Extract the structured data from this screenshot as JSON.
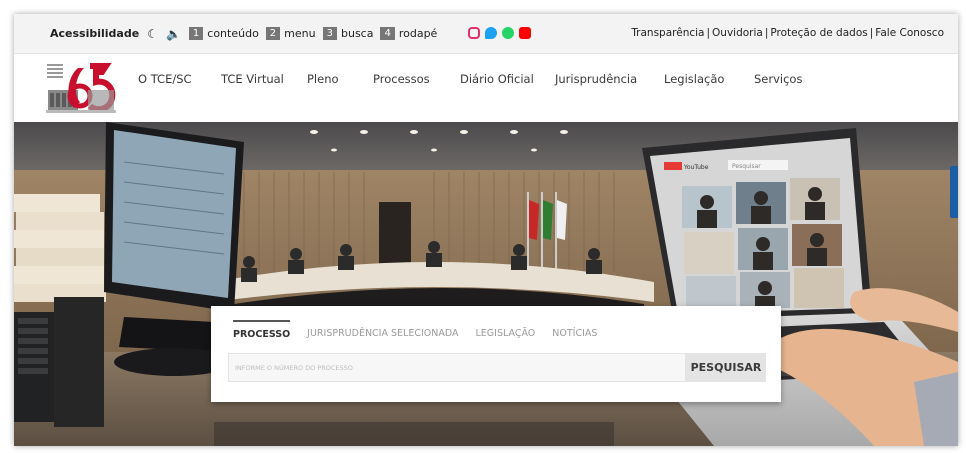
{
  "accessibility_bar": {
    "label": "Acessibilidade",
    "shortcuts": [
      {
        "num": "1",
        "text": "conteúdo"
      },
      {
        "num": "2",
        "text": "menu"
      },
      {
        "num": "3",
        "text": "busca"
      },
      {
        "num": "4",
        "text": "rodapé"
      }
    ],
    "links": [
      "Transparência",
      "Ouvidoria",
      "Proteção de dados",
      "Fale Conosco"
    ],
    "separator": "|",
    "social_colors": {
      "instagram": "#e1306c",
      "twitter": "#1da1f2",
      "whatsapp": "#25d366",
      "youtube": "#ff0000"
    }
  },
  "nav": {
    "items": [
      "O TCE/SC",
      "TCE Virtual",
      "Pleno",
      "Processos",
      "Diário Oficial",
      "Jurisprudência",
      "Legislação",
      "Serviços"
    ]
  },
  "search": {
    "tabs": [
      "PROCESSO",
      "JURISPRUDÊNCIA SELECIONADA",
      "LEGISLAÇÃO",
      "NOTÍCIAS"
    ],
    "active_tab": "PROCESSO",
    "placeholder": "INFORME O NÚMERO DO PROCESSO",
    "button_label": "PESQUISAR"
  },
  "hero": {
    "video_app_name": "YouTube",
    "video_search_placeholder": "Pesquisar"
  },
  "colors": {
    "accent_red": "#c8102e",
    "widget_blue": "#1c5ea3"
  }
}
